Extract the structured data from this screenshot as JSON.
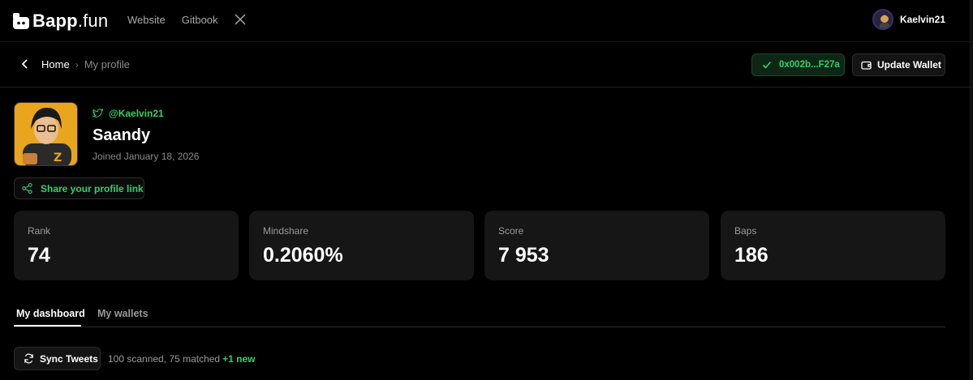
{
  "header": {
    "logo_text": "Bapp",
    "logo_suffix": ".fun",
    "nav": [
      "Website",
      "Gitbook"
    ],
    "x_icon": "x-logo-icon",
    "username": "Kaelvin21"
  },
  "breadcrumb": {
    "home": "Home",
    "separator": "›",
    "current": "My profile"
  },
  "wallet": {
    "address": "0x002b...F27a",
    "update_label": "Update Wallet"
  },
  "profile": {
    "handle": "@Kaelvin21",
    "name": "Saandy",
    "joined": "Joined January 18, 2026",
    "share_label": "Share your profile link"
  },
  "stats": [
    {
      "label": "Rank",
      "value": "74"
    },
    {
      "label": "Mindshare",
      "value": "0.2060%"
    },
    {
      "label": "Score",
      "value": "7 953"
    },
    {
      "label": "Baps",
      "value": "186"
    }
  ],
  "tabs": [
    {
      "label": "My dashboard",
      "active": true
    },
    {
      "label": "My wallets",
      "active": false
    }
  ],
  "sync": {
    "button_label": "Sync Tweets",
    "status": "100 scanned, 75 matched",
    "new": "+1 new"
  },
  "colors": {
    "accent_green": "#2fd16a",
    "background": "#000000",
    "card": "#161616"
  }
}
